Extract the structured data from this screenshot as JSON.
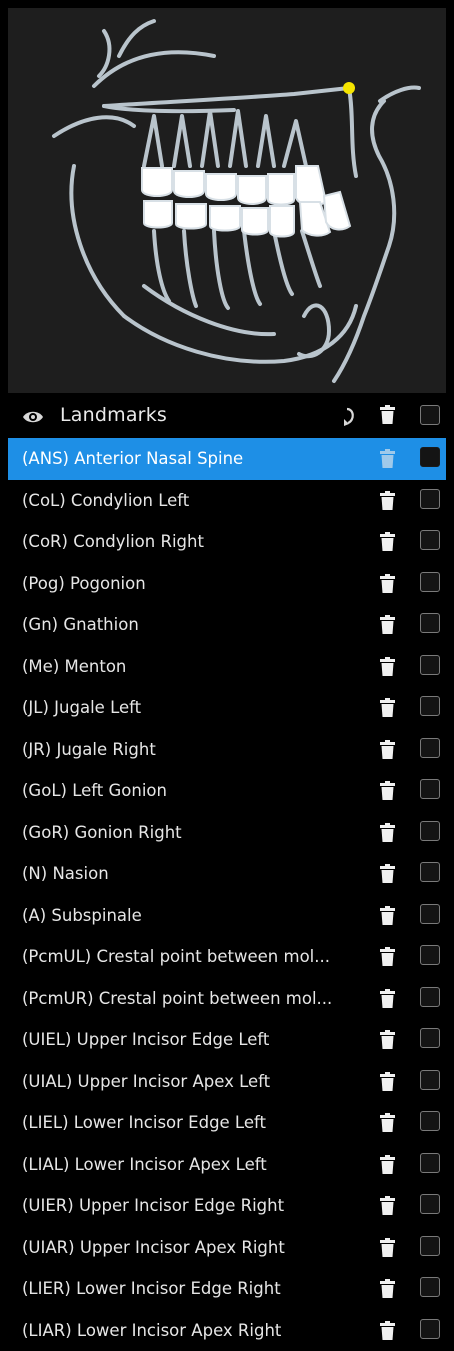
{
  "header": {
    "title": "Landmarks"
  },
  "icons": {
    "visibility": "eye-icon",
    "reset": "refresh-icon",
    "delete": "trash-icon",
    "select_all": "checkbox"
  },
  "colors": {
    "selected_row": "#1e8fe6",
    "landmark_dot": "#f5e400",
    "background": "#000000",
    "preview_background": "#1e1e1e"
  },
  "landmarks": [
    {
      "label": "(ANS) Anterior Nasal Spine",
      "selected": true
    },
    {
      "label": "(CoL) Condylion Left"
    },
    {
      "label": "(CoR) Condylion Right"
    },
    {
      "label": "(Pog) Pogonion"
    },
    {
      "label": "(Gn) Gnathion"
    },
    {
      "label": "(Me) Menton"
    },
    {
      "label": "(JL) Jugale Left"
    },
    {
      "label": "(JR) Jugale Right"
    },
    {
      "label": "(GoL) Left Gonion"
    },
    {
      "label": "(GoR) Gonion Right"
    },
    {
      "label": "(N) Nasion"
    },
    {
      "label": "(A) Subspinale"
    },
    {
      "label": "(PcmUL) Crestal point between mol..."
    },
    {
      "label": "(PcmUR) Crestal point between mol..."
    },
    {
      "label": "(UIEL) Upper Incisor Edge Left"
    },
    {
      "label": "(UIAL) Upper Incisor Apex Left"
    },
    {
      "label": "(LIEL) Lower Incisor Edge Left"
    },
    {
      "label": "(LIAL) Lower Incisor Apex Left"
    },
    {
      "label": "(UIER) Upper Incisor Edge Right"
    },
    {
      "label": "(UIAR) Upper Incisor Apex Right"
    },
    {
      "label": "(LIER) Lower Incisor Edge Right"
    },
    {
      "label": "(LIAR) Lower Incisor Apex Right"
    }
  ]
}
